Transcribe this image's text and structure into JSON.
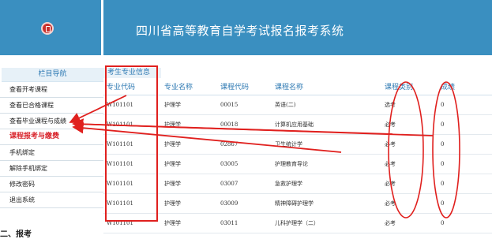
{
  "header": {
    "title": "四川省高等教育自学考试报名报考系统"
  },
  "sidebar": {
    "heading": "栏目导航",
    "items": [
      {
        "label": "查看开考课程",
        "active": false
      },
      {
        "label": "查看已合格课程",
        "active": false
      },
      {
        "label": "查看毕业课程与成绩",
        "active": false
      },
      {
        "label": "课程报考与缴费",
        "active": true
      },
      {
        "label": "手机绑定",
        "active": false
      },
      {
        "label": "解除手机绑定",
        "active": false
      },
      {
        "label": "修改密码",
        "active": false
      },
      {
        "label": "退出系统",
        "active": false
      }
    ]
  },
  "main": {
    "section_title": "考生专业信息",
    "columns": [
      "专业代码",
      "专业名称",
      "课程代码",
      "课程名称",
      "课程类别",
      "成绩"
    ],
    "rows": [
      [
        "W101101",
        "护理学",
        "00015",
        "英语(二)",
        "选考",
        "0"
      ],
      [
        "W101101",
        "护理学",
        "00018",
        "计算机应用基础",
        "必考",
        "0"
      ],
      [
        "W101101",
        "护理学",
        "02867",
        "卫生统计学",
        "必考",
        "0"
      ],
      [
        "W101101",
        "护理学",
        "03005",
        "护理教育导论",
        "必考",
        "0"
      ],
      [
        "W101101",
        "护理学",
        "03007",
        "急救护理学",
        "必考",
        "0"
      ],
      [
        "W101101",
        "护理学",
        "03009",
        "精神障碍护理学",
        "必考",
        "0"
      ],
      [
        "W101101",
        "护理学",
        "03011",
        "儿科护理学（二）",
        "必考",
        "0"
      ]
    ]
  },
  "footer_text": "二、报考",
  "colors": {
    "brand": "#3a8fc0",
    "annotation": "#e0201e",
    "link": "#2f7ab3"
  }
}
